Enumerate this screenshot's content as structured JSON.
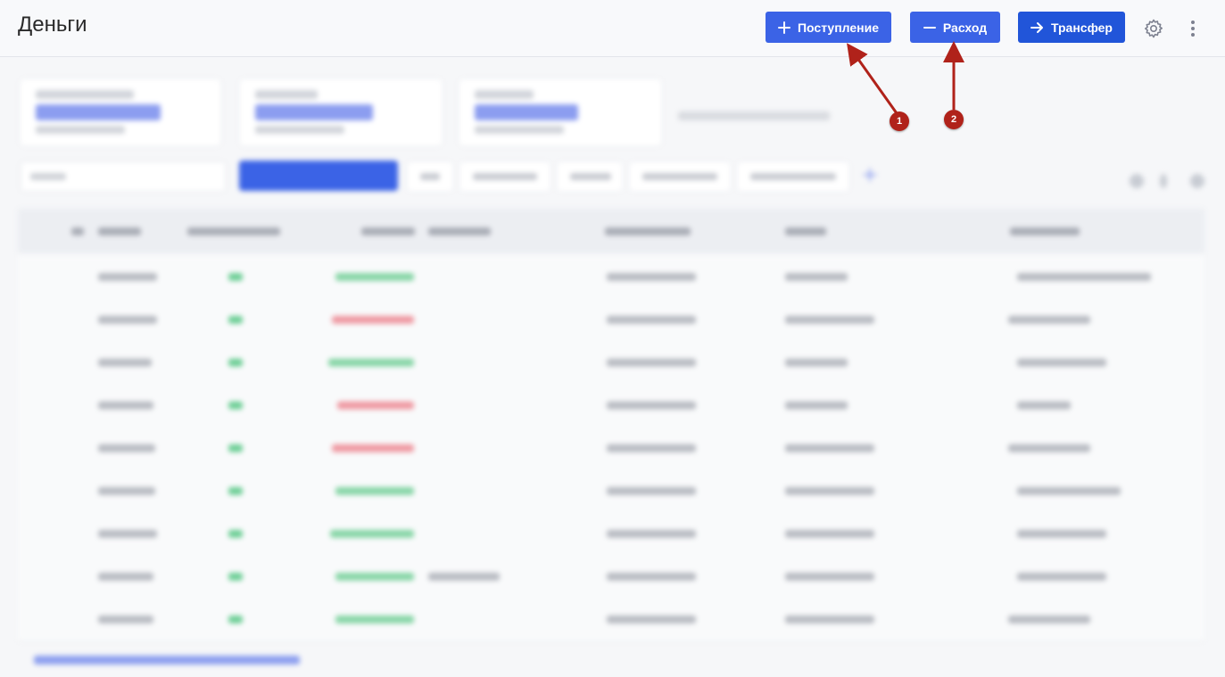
{
  "header": {
    "title": "Деньги",
    "buttons": {
      "income_label": "Поступление",
      "expense_label": "Расход",
      "transfer_label": "Трансфер"
    },
    "colors": {
      "primary": "#3b63e6",
      "primary_dark": "#2155d9"
    },
    "icons": [
      "plus-icon",
      "minus-icon",
      "arrow-right-icon",
      "gear-icon",
      "kebab-icon"
    ]
  },
  "annotations": [
    {
      "label": "1",
      "color": "#b0221a"
    },
    {
      "label": "2",
      "color": "#b0221a"
    }
  ]
}
